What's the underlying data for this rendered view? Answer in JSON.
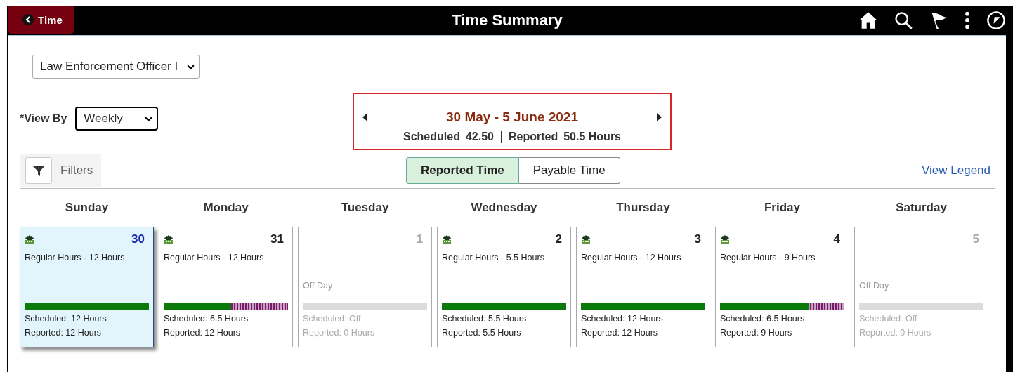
{
  "header": {
    "back_button": "Time",
    "title": "Time Summary"
  },
  "job_select": {
    "value": "Law Enforcement Officer I"
  },
  "view_by": {
    "label": "*View By",
    "value": "Weekly"
  },
  "period": {
    "range": "30 May - 5 June 2021",
    "scheduled_label": "Scheduled",
    "scheduled_value": "42.50",
    "reported_label": "Reported",
    "reported_value": "50.5 Hours"
  },
  "filters": {
    "label": "Filters"
  },
  "toggle": [
    {
      "label": "Reported Time",
      "selected": true
    },
    {
      "label": "Payable Time",
      "selected": false
    }
  ],
  "legend_link": "View Legend",
  "days": [
    {
      "weekday": "Sunday",
      "date": "30",
      "kind": "work",
      "selected": true,
      "entry": "Regular Hours - 12 Hours",
      "level": 1,
      "scheduled": "Scheduled: 12 Hours",
      "reported": "Reported: 12 Hours"
    },
    {
      "weekday": "Monday",
      "date": "31",
      "kind": "work",
      "selected": false,
      "entry": "Regular Hours - 12 Hours",
      "level": 0.54,
      "scheduled": "Scheduled: 6.5 Hours",
      "reported": "Reported: 12 Hours"
    },
    {
      "weekday": "Tuesday",
      "date": "1",
      "kind": "off",
      "selected": false,
      "entry": "Off Day",
      "level": 0,
      "scheduled": "Scheduled: Off",
      "reported": "Reported: 0 Hours"
    },
    {
      "weekday": "Wednesday",
      "date": "2",
      "kind": "work",
      "selected": false,
      "entry": "Regular Hours - 5.5 Hours",
      "level": 1,
      "scheduled": "Scheduled: 5.5 Hours",
      "reported": "Reported: 5.5 Hours"
    },
    {
      "weekday": "Thursday",
      "date": "3",
      "kind": "work",
      "selected": false,
      "entry": "Regular Hours - 12 Hours",
      "level": 1,
      "scheduled": "Scheduled: 12 Hours",
      "reported": "Reported: 12 Hours"
    },
    {
      "weekday": "Friday",
      "date": "4",
      "kind": "work",
      "selected": false,
      "entry": "Regular Hours - 9 Hours",
      "level": 0.72,
      "scheduled": "Scheduled: 6.5 Hours",
      "reported": "Reported: 9 Hours"
    },
    {
      "weekday": "Saturday",
      "date": "5",
      "kind": "off",
      "selected": false,
      "entry": "Off Day",
      "level": 0,
      "scheduled": "Scheduled: Off",
      "reported": "Reported: 0 Hours"
    }
  ]
}
